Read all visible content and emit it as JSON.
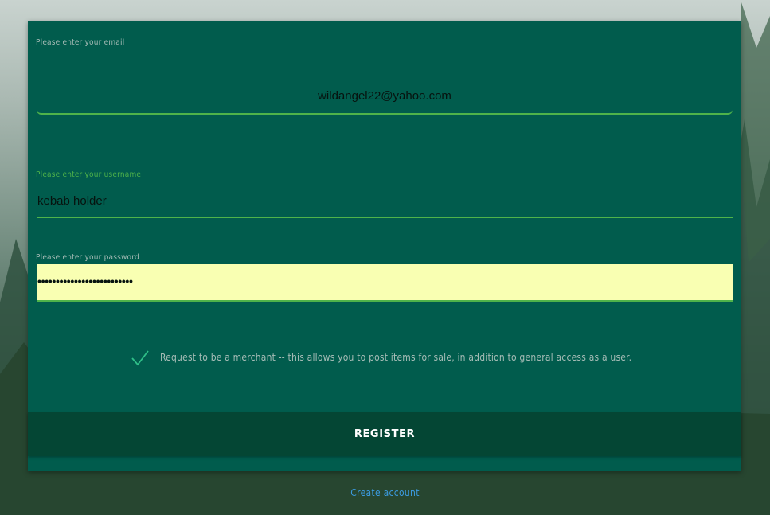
{
  "form": {
    "email_label": "Please enter your email",
    "email_value": "wildangel22@yahoo.com",
    "username_label": "Please enter your username",
    "username_value": "kebab holder",
    "password_label": "Please enter your password",
    "password_value": "••••••••••••••••••••••••••",
    "merchant_checked": true,
    "merchant_text": "Request to be a merchant -- this allows you to post items for sale, in addition to general access as a user.",
    "register_label": "REGISTER"
  },
  "footer": {
    "create_account_label": "Create account"
  },
  "colors": {
    "card_bg": "#015c4d",
    "accent_green": "#4fb34a",
    "button_bg": "#044634",
    "autofill_bg": "#f9ffb2",
    "link_blue": "#3b9be0"
  },
  "icons": {
    "merchant_check": "checkmark-icon"
  }
}
